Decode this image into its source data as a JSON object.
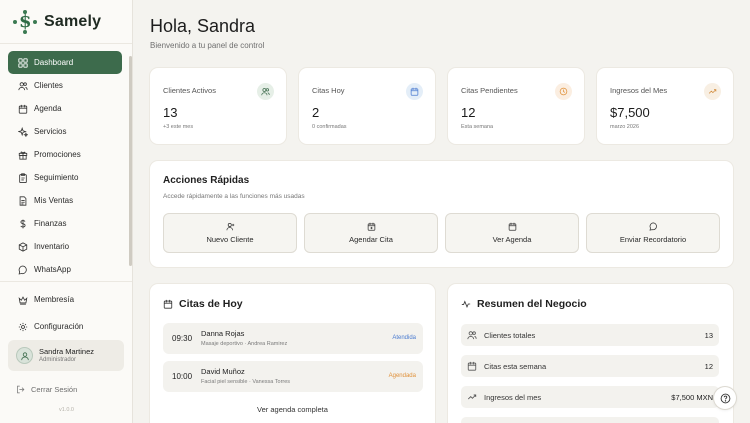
{
  "brand": {
    "name": "Samely"
  },
  "sidebar": {
    "items": [
      {
        "label": "Dashboard",
        "icon": "dashboard-icon",
        "active": true
      },
      {
        "label": "Clientes",
        "icon": "users-icon"
      },
      {
        "label": "Agenda",
        "icon": "calendar-icon"
      },
      {
        "label": "Servicios",
        "icon": "sparkles-icon"
      },
      {
        "label": "Promociones",
        "icon": "gift-icon"
      },
      {
        "label": "Seguimiento",
        "icon": "clipboard-icon"
      },
      {
        "label": "Mis Ventas",
        "icon": "document-icon"
      },
      {
        "label": "Finanzas",
        "icon": "dollar-icon"
      },
      {
        "label": "Inventario",
        "icon": "box-icon"
      },
      {
        "label": "WhatsApp",
        "icon": "message-icon"
      }
    ],
    "bottom": [
      {
        "label": "Membresía",
        "icon": "crown-icon"
      },
      {
        "label": "Configuración",
        "icon": "gear-icon"
      }
    ],
    "user": {
      "name": "Sandra Martinez",
      "role": "Administrador"
    },
    "logout": "Cerrar Sesión",
    "version": "v1.0.0"
  },
  "header": {
    "greeting": "Hola, Sandra",
    "subtitle": "Bienvenido a tu panel de control"
  },
  "stats": [
    {
      "label": "Clientes Activos",
      "value": "13",
      "note": "+3 este mes",
      "icon": "users-icon",
      "color": "#e6efe7"
    },
    {
      "label": "Citas Hoy",
      "value": "2",
      "note": "0 confirmadas",
      "icon": "calendar-icon",
      "color": "#e4eef8"
    },
    {
      "label": "Citas Pendientes",
      "value": "12",
      "note": "Esta semana",
      "icon": "clock-icon",
      "color": "#fbeee1"
    },
    {
      "label": "Ingresos del Mes",
      "value": "$7,500",
      "note": "marzo 2026",
      "icon": "trending-up-icon",
      "color": "#f8efe3"
    }
  ],
  "quick_actions": {
    "title": "Acciones Rápidas",
    "subtitle": "Accede rápidamente a las funciones más usadas",
    "buttons": [
      {
        "label": "Nuevo Cliente",
        "icon": "user-plus-icon"
      },
      {
        "label": "Agendar Cita",
        "icon": "calendar-plus-icon"
      },
      {
        "label": "Ver Agenda",
        "icon": "calendar-icon"
      },
      {
        "label": "Enviar Recordatorio",
        "icon": "message-icon"
      }
    ]
  },
  "today": {
    "title": "Citas de Hoy",
    "appointments": [
      {
        "time": "09:30",
        "name": "Danna Rojas",
        "desc": "Masaje deportivo · Andrea Ramirez",
        "status": "Atendida",
        "status_color": "#4a7bd0"
      },
      {
        "time": "10:00",
        "name": "David Muñoz",
        "desc": "Facial piel sensible · Vanessa Torres",
        "status": "Agendada",
        "status_color": "#e0913a"
      }
    ],
    "see_all": "Ver agenda completa"
  },
  "summary": {
    "title": "Resumen del Negocio",
    "rows": [
      {
        "label": "Clientes totales",
        "value": "13",
        "icon": "users-icon"
      },
      {
        "label": "Citas esta semana",
        "value": "12",
        "icon": "calendar-icon"
      },
      {
        "label": "Ingresos del mes",
        "value": "$7,500 MXN",
        "icon": "trending-up-icon"
      }
    ]
  },
  "colors": {
    "accent": "#3d6b4c",
    "page_bg": "#f4f3ef"
  }
}
